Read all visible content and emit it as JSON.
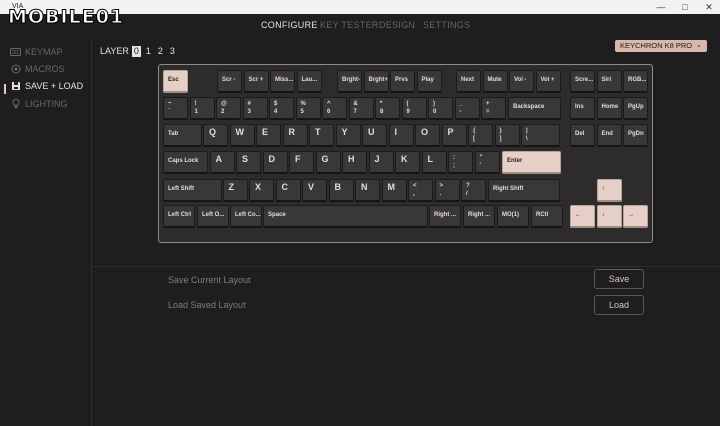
{
  "window": {
    "title": "VIA",
    "controls": [
      "—",
      "□",
      "✕"
    ]
  },
  "watermark": "MOBILE01",
  "nav": {
    "tabs": [
      "CONFIGURE",
      "KEY TESTER",
      "DESIGN",
      "SETTINGS"
    ],
    "active": "CONFIGURE"
  },
  "sidebar": {
    "items": [
      {
        "label": "KEYMAP",
        "icon": "keyboard-icon",
        "active": false
      },
      {
        "label": "MACROS",
        "icon": "macro-icon",
        "active": false
      },
      {
        "label": "SAVE + LOAD",
        "icon": "save-icon",
        "active": true
      },
      {
        "label": "LIGHTING",
        "icon": "lightbulb-icon",
        "active": false
      }
    ]
  },
  "layer": {
    "label": "LAYER",
    "options": [
      "0",
      "1",
      "2",
      "3"
    ],
    "selected": "0"
  },
  "keyboard_select": {
    "value": "KEYCHRON K8 PRO",
    "chevron": "⌄"
  },
  "colors": {
    "background": "#1f1e1e",
    "accent": "#e6cfc6",
    "key": "#3a3737",
    "selector": "#d9b7ab"
  },
  "keys": [
    {
      "label": "Esc",
      "accent": true
    },
    {
      "label": "Scr -"
    },
    {
      "label": "Scr +"
    },
    {
      "label": "Miss..."
    },
    {
      "label": "Lau..."
    },
    {
      "label": "Brght-"
    },
    {
      "label": "Brght+"
    },
    {
      "label": "Prvs"
    },
    {
      "label": "Play"
    },
    {
      "label": "Next"
    },
    {
      "label": "Mute"
    },
    {
      "label": "Vol -"
    },
    {
      "label": "Vol +"
    },
    {
      "label": "Scre..."
    },
    {
      "label": "Siri"
    },
    {
      "label": "RGB..."
    },
    {
      "shift": "~",
      "base": "`"
    },
    {
      "shift": "!",
      "base": "1"
    },
    {
      "shift": "@",
      "base": "2"
    },
    {
      "shift": "#",
      "base": "3"
    },
    {
      "shift": "$",
      "base": "4"
    },
    {
      "shift": "%",
      "base": "5"
    },
    {
      "shift": "^",
      "base": "6"
    },
    {
      "shift": "&",
      "base": "7"
    },
    {
      "shift": "*",
      "base": "8"
    },
    {
      "shift": "(",
      "base": "9"
    },
    {
      "shift": ")",
      "base": "0"
    },
    {
      "shift": "_",
      "base": "-"
    },
    {
      "shift": "+",
      "base": "="
    },
    {
      "label": "Backspace"
    },
    {
      "label": "Ins"
    },
    {
      "label": "Home"
    },
    {
      "label": "PgUp"
    },
    {
      "label": "Tab"
    },
    {
      "label": "Q",
      "alpha": true
    },
    {
      "label": "W",
      "alpha": true
    },
    {
      "label": "E",
      "alpha": true
    },
    {
      "label": "R",
      "alpha": true
    },
    {
      "label": "T",
      "alpha": true
    },
    {
      "label": "Y",
      "alpha": true
    },
    {
      "label": "U",
      "alpha": true
    },
    {
      "label": "I",
      "alpha": true
    },
    {
      "label": "O",
      "alpha": true
    },
    {
      "label": "P",
      "alpha": true
    },
    {
      "shift": "{",
      "base": "["
    },
    {
      "shift": "}",
      "base": "]"
    },
    {
      "shift": "|",
      "base": "\\"
    },
    {
      "label": "Del"
    },
    {
      "label": "End"
    },
    {
      "label": "PgDn"
    },
    {
      "label": "Caps Lock"
    },
    {
      "label": "A",
      "alpha": true
    },
    {
      "label": "S",
      "alpha": true
    },
    {
      "label": "D",
      "alpha": true
    },
    {
      "label": "F",
      "alpha": true
    },
    {
      "label": "G",
      "alpha": true
    },
    {
      "label": "H",
      "alpha": true
    },
    {
      "label": "J",
      "alpha": true
    },
    {
      "label": "K",
      "alpha": true
    },
    {
      "label": "L",
      "alpha": true
    },
    {
      "shift": ":",
      "base": ";"
    },
    {
      "shift": "\"",
      "base": "'"
    },
    {
      "label": "Enter",
      "accent": true
    },
    {
      "label": "Left Shift"
    },
    {
      "label": "Z",
      "alpha": true
    },
    {
      "label": "X",
      "alpha": true
    },
    {
      "label": "C",
      "alpha": true
    },
    {
      "label": "V",
      "alpha": true
    },
    {
      "label": "B",
      "alpha": true
    },
    {
      "label": "N",
      "alpha": true
    },
    {
      "label": "M",
      "alpha": true
    },
    {
      "shift": "<",
      "base": ","
    },
    {
      "shift": ">",
      "base": "."
    },
    {
      "shift": "?",
      "base": "/"
    },
    {
      "label": "Right Shift"
    },
    {
      "label": "↑",
      "accent": true
    },
    {
      "label": "Left Ctrl"
    },
    {
      "label": "Left O..."
    },
    {
      "label": "Left Co..."
    },
    {
      "label": "Space"
    },
    {
      "label": "Right ..."
    },
    {
      "label": "Right ..."
    },
    {
      "label": "MO(1)"
    },
    {
      "label": "RCtl"
    },
    {
      "label": "←",
      "accent": true
    },
    {
      "label": "↓",
      "accent": true
    },
    {
      "label": "→",
      "accent": true
    }
  ],
  "save_load": {
    "save_label": "Save Current Layout",
    "save_button": "Save",
    "load_label": "Load Saved Layout",
    "load_button": "Load"
  }
}
